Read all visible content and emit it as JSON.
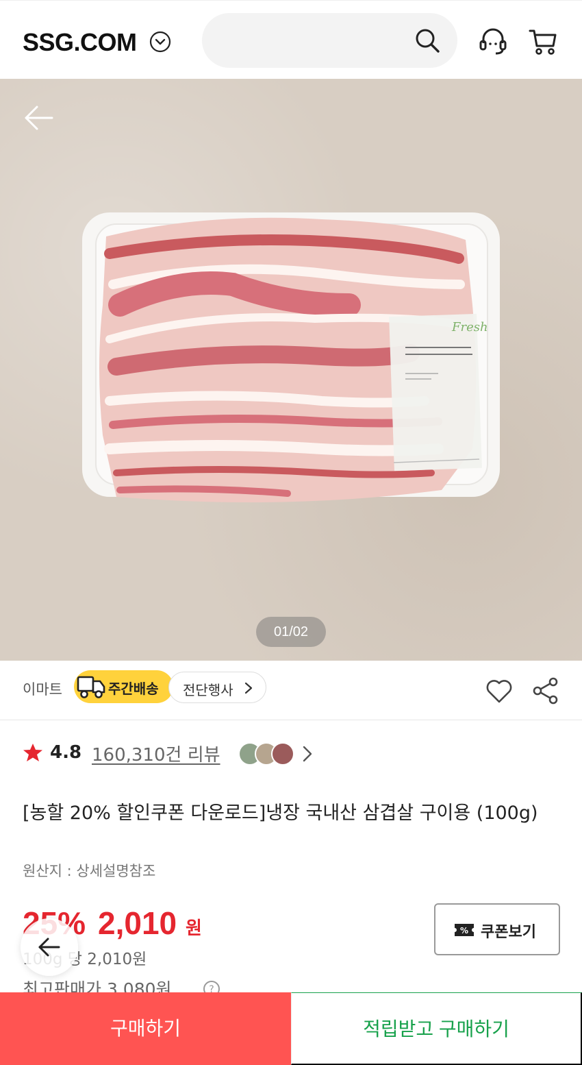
{
  "header": {
    "logo_text": "SSG.COM",
    "search_placeholder": "",
    "icons": [
      "chevron-down-icon",
      "search-icon",
      "headset-icon",
      "cart-icon"
    ]
  },
  "gallery": {
    "pager": "01/02",
    "icons": [
      "back-arrow-icon"
    ]
  },
  "seller": {
    "name": "이마트",
    "delivery_badge": "주간배송",
    "event_link": "전단행사",
    "icons": [
      "truck-icon",
      "heart-icon",
      "share-icon"
    ]
  },
  "rating": {
    "score": "4.8",
    "reviews": "160,310건 리뷰",
    "star_color": "#e5262f"
  },
  "product": {
    "title": "[농할 20% 할인쿠폰 다운로드]냉장 국내산 삼겹살 구이용 (100g)",
    "origin": "원산지 : 상세설명참조"
  },
  "price": {
    "discount": "25%",
    "amount": "2,010",
    "currency": "원",
    "unit_price": "100g 당 2,010원",
    "max_price": "최고판매가 3,080원",
    "color": "#e5262f"
  },
  "coupon": {
    "label": "쿠폰보기"
  },
  "bottom": {
    "buy_label": "구매하기",
    "buy_reward_label": "적립받고 구매하기",
    "buy_color": "#ff5452",
    "reward_color": "#17a14b"
  }
}
